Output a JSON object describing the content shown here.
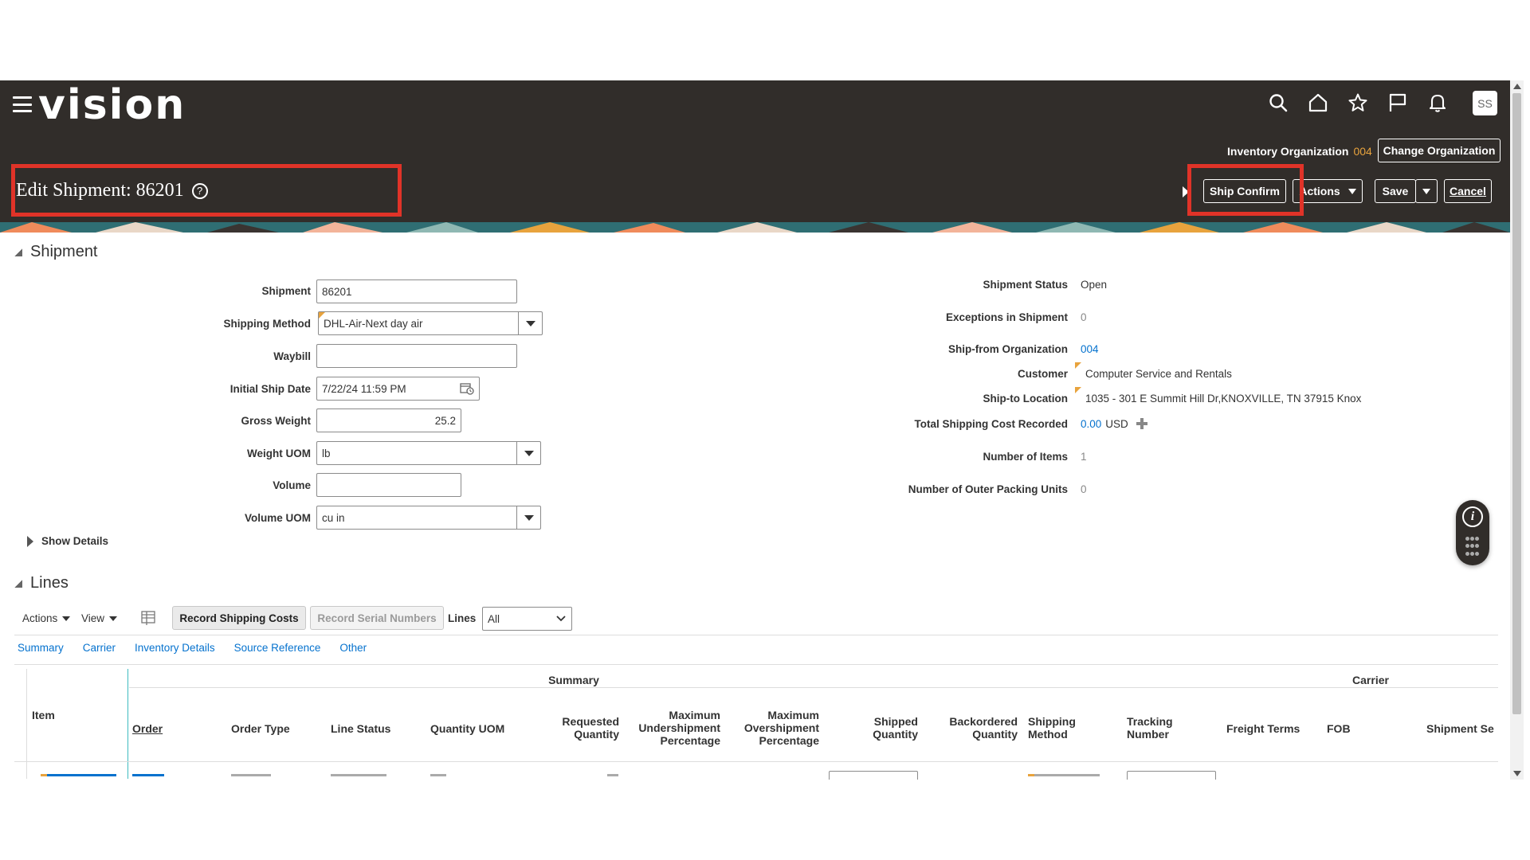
{
  "app": {
    "logo": "vision",
    "avatar_initials": "SS",
    "header_icons": [
      "search-icon",
      "home-icon",
      "star-icon",
      "flag-icon",
      "bell-icon"
    ]
  },
  "org": {
    "label": "Inventory Organization",
    "code": "004",
    "change_button": "Change Organization"
  },
  "page": {
    "title": "Edit Shipment: 86201",
    "help": "?"
  },
  "toolbar": {
    "ship_confirm": "Ship Confirm",
    "actions": "Actions",
    "save": "Save",
    "cancel": "Cancel"
  },
  "shipment_section": {
    "title": "Shipment",
    "fields": {
      "shipment": {
        "label": "Shipment",
        "value": "86201"
      },
      "shipping_method": {
        "label": "Shipping Method",
        "value": "DHL-Air-Next day air"
      },
      "waybill": {
        "label": "Waybill",
        "value": ""
      },
      "initial_ship_date": {
        "label": "Initial Ship Date",
        "value": "7/22/24 11:59 PM"
      },
      "gross_weight": {
        "label": "Gross Weight",
        "value": "25.2"
      },
      "weight_uom": {
        "label": "Weight UOM",
        "value": "lb"
      },
      "volume": {
        "label": "Volume",
        "value": ""
      },
      "volume_uom": {
        "label": "Volume UOM",
        "value": "cu in"
      }
    },
    "show_details": "Show Details",
    "info": {
      "status": {
        "label": "Shipment Status",
        "value": "Open"
      },
      "exceptions": {
        "label": "Exceptions in Shipment",
        "value": "0"
      },
      "ship_from": {
        "label": "Ship-from Organization",
        "value": "004"
      },
      "customer": {
        "label": "Customer",
        "value": "Computer Service and Rentals"
      },
      "ship_to": {
        "label": "Ship-to Location",
        "value": "1035 - 301 E Summit Hill Dr,KNOXVILLE, TN 37915 Knox"
      },
      "shipping_cost": {
        "label": "Total Shipping Cost Recorded",
        "value": "0.00",
        "currency": "USD"
      },
      "num_items": {
        "label": "Number of Items",
        "value": "1"
      },
      "outer_units": {
        "label": "Number of Outer Packing Units",
        "value": "0"
      }
    }
  },
  "lines_section": {
    "title": "Lines",
    "toolbar": {
      "actions": "Actions",
      "view": "View",
      "record_shipping_costs": "Record Shipping Costs",
      "record_serial_numbers": "Record Serial Numbers",
      "lines_label": "Lines",
      "lines_filter": "All"
    },
    "sub_tabs": [
      "Summary",
      "Carrier",
      "Inventory Details",
      "Source Reference",
      "Other"
    ],
    "group_headers": {
      "summary": "Summary",
      "carrier": "Carrier"
    },
    "columns": {
      "item": "Item",
      "order": "Order",
      "order_type": "Order Type",
      "line_status": "Line Status",
      "quantity_uom": "Quantity UOM",
      "requested_quantity": "Requested Quantity",
      "max_under": "Maximum Undershipment Percentage",
      "max_over": "Maximum Overshipment Percentage",
      "shipped_quantity": "Shipped Quantity",
      "backordered_quantity": "Backordered Quantity",
      "shipping_method": "Shipping Method",
      "tracking_number": "Tracking Number",
      "freight_terms": "Freight Terms",
      "fob": "FOB",
      "shipment_se": "Shipment Se"
    }
  },
  "colors": {
    "header_bg": "#312d2a",
    "highlight_red": "#e03328",
    "link_blue": "#0572ce",
    "accent_orange": "#e8a33d"
  }
}
